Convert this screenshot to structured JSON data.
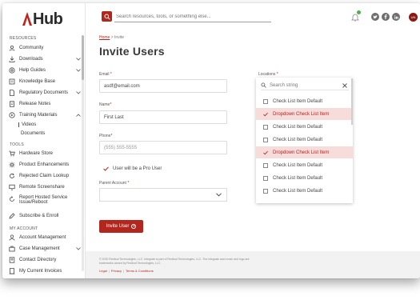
{
  "app": {
    "logo_text": "Hub"
  },
  "search": {
    "placeholder": "Search resources, tools, or something else..."
  },
  "header": {
    "avatar_initials": "UN"
  },
  "sidebar": {
    "resources_label": "RESOURCES",
    "tools_label": "TOOLS",
    "account_label": "MY ACCOUNT",
    "items": [
      {
        "label": "Community",
        "icon": "community-icon"
      },
      {
        "label": "Downloads",
        "icon": "download-icon"
      },
      {
        "label": "Help Guides",
        "icon": "help-icon"
      },
      {
        "label": "Knowledge Base",
        "icon": "book-icon"
      },
      {
        "label": "Regulatory Documents",
        "icon": "document-icon"
      },
      {
        "label": "Release Notes",
        "icon": "notes-icon"
      },
      {
        "label": "Training Materials",
        "icon": "play-icon"
      },
      {
        "label": "Hardware Store",
        "icon": "cart-icon"
      },
      {
        "label": "Product Enhancements",
        "icon": "gear-icon"
      },
      {
        "label": "Rejected Claim Lookup",
        "icon": "refresh-icon"
      },
      {
        "label": "Remote Screenshare",
        "icon": "screen-icon"
      },
      {
        "label": "Report Hosted Service Issue/Reboot",
        "icon": "reboot-icon"
      },
      {
        "label": "Subscribe & Enroll",
        "icon": "pen-icon"
      },
      {
        "label": "Account Management",
        "icon": "user-icon"
      },
      {
        "label": "Case Management",
        "icon": "case-icon"
      },
      {
        "label": "Contact Directory",
        "icon": "contact-icon"
      },
      {
        "label": "My Current Invoices",
        "icon": "invoice-icon"
      }
    ],
    "subitems": [
      {
        "label": "Videos"
      },
      {
        "label": "Documents"
      }
    ]
  },
  "breadcrumb": {
    "home": "Home",
    "separator": ">",
    "current": "Invite"
  },
  "page": {
    "title": "Invite Users"
  },
  "form": {
    "email_label": "Email",
    "email_value": "asdf@email.com",
    "name_label": "Name",
    "name_value": "First Last",
    "phone_label": "Phone",
    "phone_placeholder": "(555) 555-5555",
    "pro_user_label": "User will be a Pro User",
    "parent_account_label": "Parent Account",
    "required_mark": "*",
    "submit_label": "Invite User"
  },
  "locations": {
    "label": "Locations",
    "search_placeholder": "Search string",
    "items": [
      {
        "label": "Check List Item Default",
        "selected": false
      },
      {
        "label": "Dropdown Check List Item",
        "selected": true
      },
      {
        "label": "Check List Item Default",
        "selected": false
      },
      {
        "label": "Check List Item Default",
        "selected": false
      },
      {
        "label": "Dropdown Check List Item",
        "selected": true
      },
      {
        "label": "Check List Item Default",
        "selected": false
      },
      {
        "label": "Check List Item Default",
        "selected": false
      },
      {
        "label": "Check List Item Default",
        "selected": false
      }
    ]
  },
  "footer": {
    "copyright": "© 2020 Redbud Technologies, LLC. Integrate is part of Redbud Technologies, LLC. The integrate word mark and logo are trademarks owned by Redbud Technologies, LLC.",
    "links": [
      "Legal",
      "Privacy",
      "Terms & Conditions"
    ]
  },
  "colors": {
    "accent": "#b3261e",
    "selected_bg": "#f6dcdb",
    "badge": "#4caf50"
  }
}
